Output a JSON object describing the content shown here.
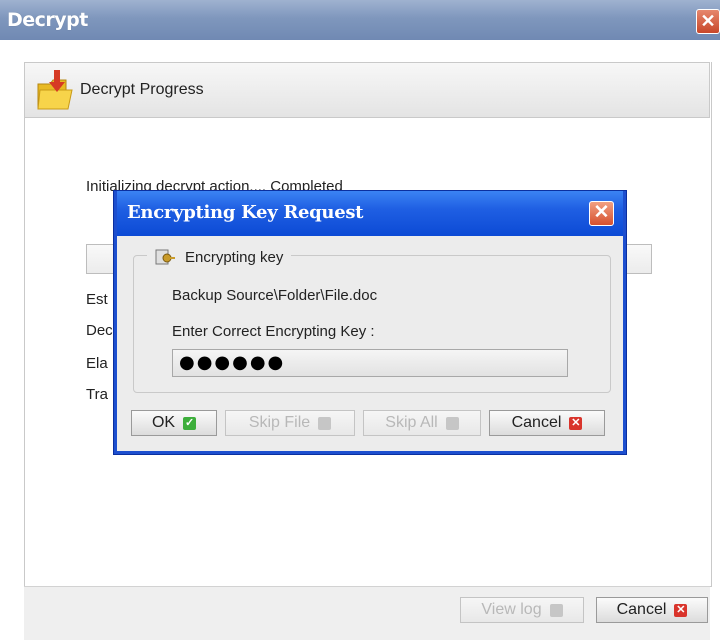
{
  "window": {
    "title": "Decrypt",
    "close_symbol": "✕"
  },
  "header": {
    "title": "Decrypt Progress"
  },
  "status": {
    "line1": "Initializing decrypt action.... Completed",
    "info_lines": [
      "Est",
      "Dec",
      "Ela",
      "Tra"
    ]
  },
  "footer": {
    "view_log_label": "View log",
    "cancel_label": "Cancel"
  },
  "dialog": {
    "title": "Encrypting Key Request",
    "close_symbol": "✕",
    "group_label": "Encrypting key",
    "file_path": "Backup Source\\Folder\\File.doc",
    "prompt": "Enter Correct Encrypting Key :",
    "password_value": "●●●●●●",
    "buttons": {
      "ok": "OK",
      "skip_file": "Skip File",
      "skip_all": "Skip All",
      "cancel": "Cancel"
    }
  },
  "colors": {
    "dialog_title_blue": "#1f5fe3",
    "window_title": "#7f97bd",
    "cancel_red": "#d9342b",
    "ok_green": "#3dae3b"
  }
}
